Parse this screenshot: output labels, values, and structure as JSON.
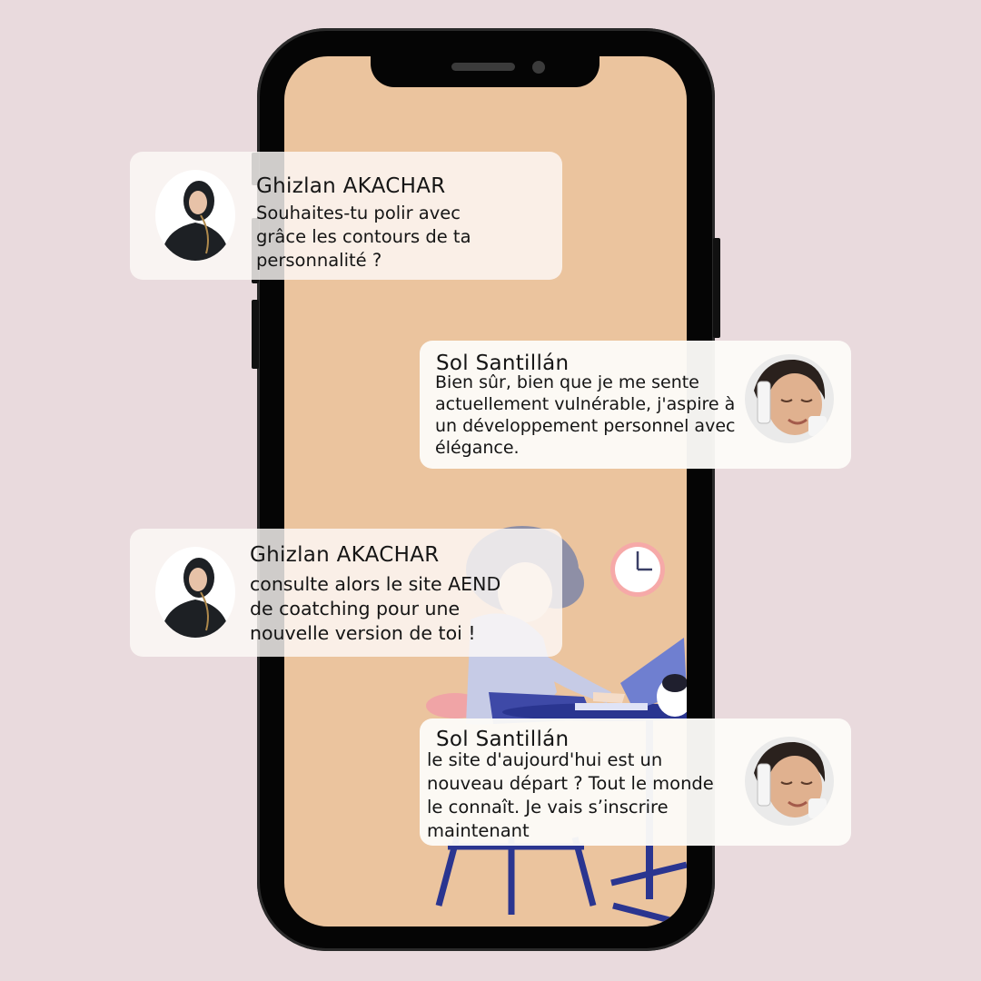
{
  "colors": {
    "background": "#e9dadd",
    "phone_frame": "#050505",
    "screen": "#ebc49e",
    "bubble": "#fbf9f6",
    "text": "#151515"
  },
  "messages": [
    {
      "sender": "Ghizlan AKACHAR",
      "text": "Souhaites-tu polir avec\ngrâce les contours de ta\npersonnalité ?",
      "align": "left",
      "avatar_icon": "woman-hijab-avatar-icon"
    },
    {
      "sender": "Sol Santillán",
      "text": "Bien sûr, bien que je me sente\nactuellement vulnérable, j'aspire à\nun développement personnel avec\nélégance.",
      "align": "right",
      "avatar_icon": "woman-skincare-avatar-icon"
    },
    {
      "sender": "Ghizlan AKACHAR",
      "text": "consulte alors le site AEND\nde coatching pour une\nnouvelle version de toi !",
      "align": "left",
      "avatar_icon": "woman-hijab-avatar-icon"
    },
    {
      "sender": "Sol Santillán",
      "text": " le site d'aujourd'hui est un\nnouveau départ ? Tout le monde\nle connaît. Je vais s’inscrire\nmaintenant",
      "align": "right",
      "avatar_icon": "woman-skincare-avatar-icon"
    }
  ]
}
